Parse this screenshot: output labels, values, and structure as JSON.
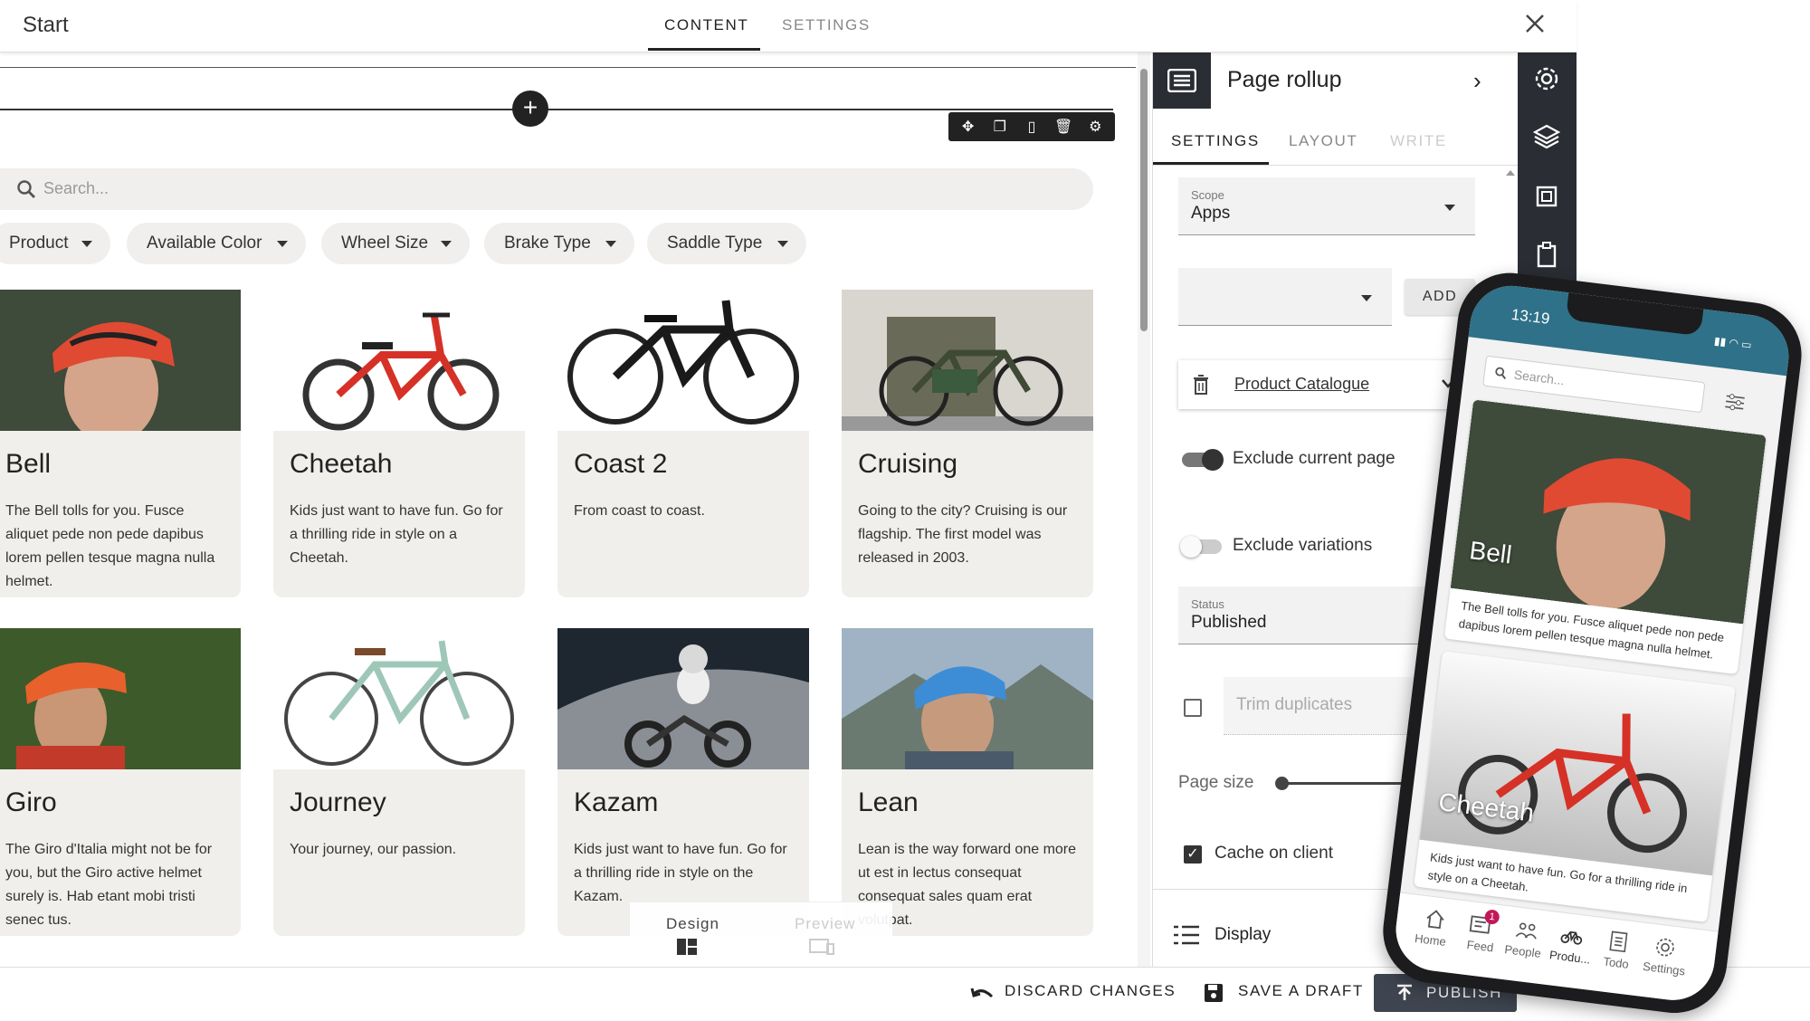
{
  "topbar": {
    "title": "Start",
    "tabs": [
      {
        "label": "CONTENT",
        "active": true
      },
      {
        "label": "SETTINGS",
        "active": false
      }
    ]
  },
  "canvas": {
    "search_placeholder": "Search...",
    "filters": [
      "Product",
      "Available Color",
      "Wheel Size",
      "Brake Type",
      "Saddle Type"
    ],
    "cards": [
      {
        "name": "Bell",
        "desc": "The Bell tolls for you. Fusce aliquet pede non pede dapibus lorem pellen tesque magna nulla helmet.",
        "img": "helmet-rider"
      },
      {
        "name": "Cheetah",
        "desc": "Kids just want to have fun. Go for a thrilling ride in style on a Cheetah.",
        "img": "red-kids-bike"
      },
      {
        "name": "Coast 2",
        "desc": "From coast to coast.",
        "img": "black-ebike"
      },
      {
        "name": "Cruising",
        "desc": "Going to the city? Cruising is our flagship. The first model was released in 2003.",
        "img": "city-bike"
      },
      {
        "name": "Giro",
        "desc": "The Giro d'Italia might not be for you, but the Giro active helmet surely is. Hab etant mobi tristi senec tus.",
        "img": "orange-helmet-rider"
      },
      {
        "name": "Journey",
        "desc": "Your journey, our passion.",
        "img": "mint-bike"
      },
      {
        "name": "Kazam",
        "desc": "Kids just want to have fun. Go for a thrilling ride in style on the Kazam.",
        "img": "balance-bike-kid"
      },
      {
        "name": "Lean",
        "desc": "Lean is the way forward one more ut est in lectus consequat consequat sales quam erat volutpat.",
        "img": "blue-helmet-rider"
      }
    ]
  },
  "mode_toggle": {
    "design": "Design",
    "preview": "Preview"
  },
  "bottombar": {
    "discard": "DISCARD CHANGES",
    "save": "SAVE A DRAFT",
    "publish": "PUBLISH"
  },
  "panel": {
    "title": "Page rollup",
    "tabs": [
      {
        "label": "SETTINGS",
        "state": "active"
      },
      {
        "label": "LAYOUT",
        "state": "normal"
      },
      {
        "label": "WRITE",
        "state": "disabled"
      }
    ],
    "scope": {
      "label": "Scope",
      "value": "Apps"
    },
    "add_label": "ADD",
    "source": "Product Catalogue",
    "exclude_current": {
      "label": "Exclude current page",
      "on": true
    },
    "exclude_variations": {
      "label": "Exclude variations",
      "on": false
    },
    "status": {
      "label": "Status",
      "value": "Published"
    },
    "trim_duplicates": {
      "label": "Trim duplicates",
      "checked": false
    },
    "page_size": {
      "label": "Page size",
      "value": "30",
      "fraction": 0.0
    },
    "cache": {
      "label": "Cache on client",
      "checked": true
    },
    "display_label": "Display"
  },
  "phone": {
    "time": "13:19",
    "search_placeholder": "Search...",
    "cards": [
      {
        "title": "Bell",
        "desc": "The Bell tolls for you. Fusce aliquet pede non pede dapibus lorem pellen tesque magna nulla helmet."
      },
      {
        "title": "Cheetah",
        "desc": "Kids just want to have fun. Go for a thrilling ride in style on a Cheetah."
      }
    ],
    "tabs": [
      "Home",
      "Feed",
      "People",
      "Produ...",
      "Todo",
      "Settings"
    ],
    "feed_badge": "1"
  },
  "colors": {
    "dark": "#2a2d33",
    "card_bg": "#f0efec",
    "phone_header": "#2f7188",
    "badge": "#c2185b"
  }
}
